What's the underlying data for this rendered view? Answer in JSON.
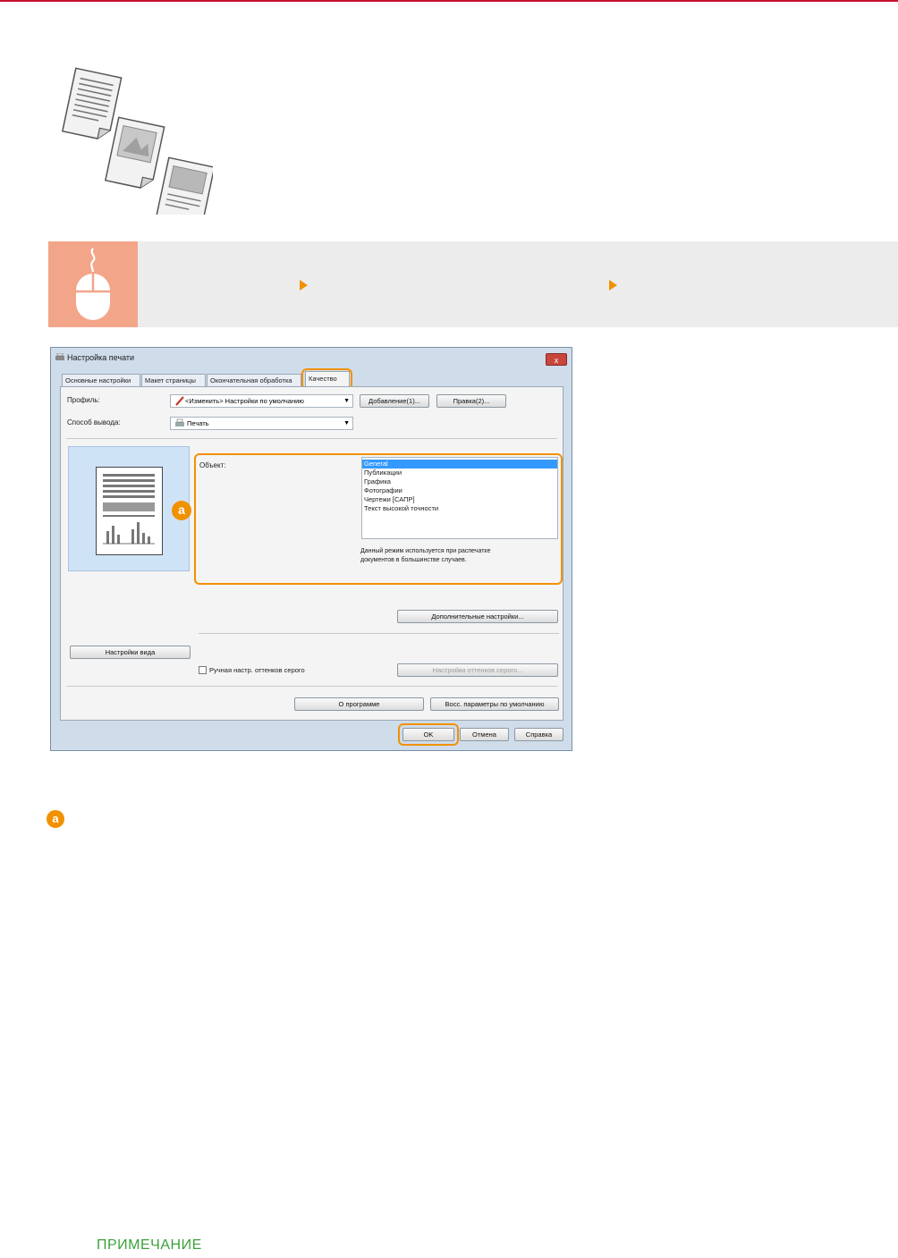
{
  "dialog": {
    "title": "Настройка печати",
    "close_label": "x",
    "tabs": [
      "Основные настройки",
      "Макет страницы",
      "Окончательная обработка",
      "Качество"
    ],
    "profile_label": "Профиль:",
    "profile_value": "<Изменить> Настройки по умолчанию",
    "add_button": "Добавление(1)...",
    "edit_button": "Правка(2)...",
    "output_label": "Способ вывода:",
    "output_value": "Печать",
    "object_label": "Объект:",
    "object_options": [
      "General",
      "Публикации",
      "Графика",
      "Фотографии",
      "Чертежи [САПР]",
      "Текст высокой точности"
    ],
    "object_selected": "General",
    "description": [
      "Данный режим используется при распечатке",
      "документов в большинстве случаев."
    ],
    "advanced_button": "Дополнительные настройки...",
    "view_settings_button": "Настройки вида",
    "manual_gray_label": "Ручная настр. оттенков серого",
    "manual_gray_checked": false,
    "gray_settings_button": "Настройки оттенков серого...",
    "about_button": "О программе",
    "restore_button": "Восс. параметры по умолчанию",
    "ok_button": "OK",
    "cancel_button": "Отмена",
    "help_button": "Справка"
  },
  "callout": {
    "marker": "a"
  },
  "note": {
    "title": "ПРИМЕЧАНИЕ"
  },
  "colors": {
    "accent": "#f29100",
    "mouse_bg": "#f3a58a",
    "note_green": "#3aa13a",
    "top_rule": "#c8102e"
  },
  "icons": [
    "documents-illustration-icon",
    "mouse-icon",
    "arrow-right-icon",
    "printer-icon",
    "pencil-icon"
  ]
}
